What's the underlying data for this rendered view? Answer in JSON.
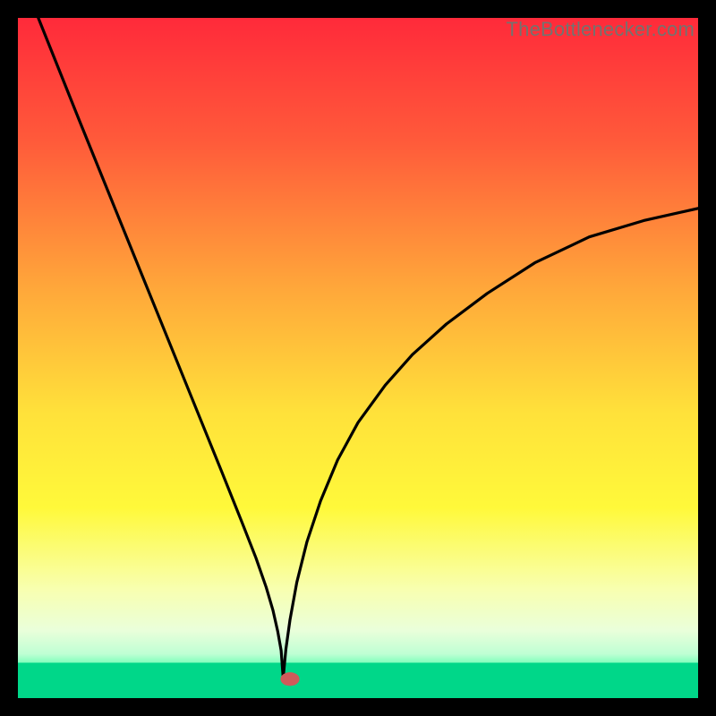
{
  "watermark": {
    "text": "TheBottlenecker.com"
  },
  "chart_data": {
    "type": "line",
    "title": "",
    "xlabel": "",
    "ylabel": "",
    "xlim": [
      0,
      100
    ],
    "ylim": [
      0,
      100
    ],
    "x_cusp": 39,
    "left": {
      "x_start": 3,
      "y_start": 100
    },
    "right": {
      "x_end": 100,
      "y_end": 72
    },
    "marker": {
      "x": 40,
      "y": 2.8,
      "rx": 1.4,
      "ry": 1.0,
      "color": "#cf5a5a"
    },
    "green_band": {
      "y_top": 5.2,
      "y_bottom": 0
    },
    "gradient_stops": [
      {
        "offset": 0.0,
        "color": "#ff2a3a"
      },
      {
        "offset": 0.18,
        "color": "#ff5a3a"
      },
      {
        "offset": 0.4,
        "color": "#ffa83a"
      },
      {
        "offset": 0.58,
        "color": "#ffe13a"
      },
      {
        "offset": 0.72,
        "color": "#fff93a"
      },
      {
        "offset": 0.84,
        "color": "#f8ffb0"
      },
      {
        "offset": 0.9,
        "color": "#eaffda"
      },
      {
        "offset": 0.935,
        "color": "#bfffd4"
      },
      {
        "offset": 0.955,
        "color": "#60ffb0"
      },
      {
        "offset": 0.975,
        "color": "#00e890"
      },
      {
        "offset": 1.0,
        "color": "#00d789"
      }
    ],
    "curve_left": [
      [
        3,
        100
      ],
      [
        6,
        92.5
      ],
      [
        9,
        85
      ],
      [
        12,
        77.6
      ],
      [
        15,
        70.2
      ],
      [
        18,
        62.8
      ],
      [
        21,
        55.4
      ],
      [
        24,
        48
      ],
      [
        27,
        40.6
      ],
      [
        30,
        33.2
      ],
      [
        33,
        25.7
      ],
      [
        35,
        20.6
      ],
      [
        36.5,
        16.3
      ],
      [
        37.5,
        12.9
      ],
      [
        38.2,
        9.8
      ],
      [
        38.7,
        7
      ],
      [
        39,
        3
      ]
    ],
    "curve_right": [
      [
        39,
        3
      ],
      [
        39.4,
        7.2
      ],
      [
        40,
        11.5
      ],
      [
        41,
        17
      ],
      [
        42.5,
        23
      ],
      [
        44.5,
        29
      ],
      [
        47,
        35
      ],
      [
        50,
        40.5
      ],
      [
        54,
        46
      ],
      [
        58,
        50.5
      ],
      [
        63,
        55
      ],
      [
        69,
        59.5
      ],
      [
        76,
        64
      ],
      [
        84,
        67.8
      ],
      [
        92,
        70.2
      ],
      [
        100,
        72
      ]
    ]
  }
}
